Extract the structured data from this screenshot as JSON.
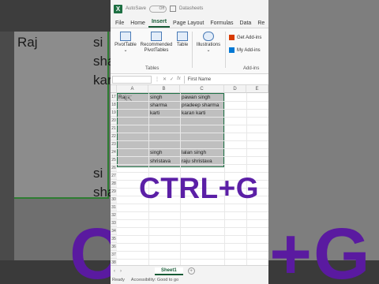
{
  "background": {
    "cells": [
      "Raj",
      "si",
      "sha",
      "kar",
      "si",
      "sha"
    ],
    "overlay_text": "CTRL+G"
  },
  "window": {
    "autosave_label": "AutoSave",
    "toggle_state": "Off",
    "workbook_name": "Datasheets"
  },
  "tabs": [
    "File",
    "Home",
    "Insert",
    "Page Layout",
    "Formulas",
    "Data",
    "Re"
  ],
  "active_tab": "Insert",
  "ribbon": {
    "pivot_table": "PivotTable",
    "recommended_pivot": "Recommended PivotTables",
    "table": "Table",
    "tables_group": "Tables",
    "illustrations": "Illustrations",
    "get_addins": "Get Add-ins",
    "my_addins": "My Add-ins",
    "addins_group": "Add-ins"
  },
  "formula_bar": {
    "fx_label": "fx",
    "value": "First Name"
  },
  "columns": [
    "A",
    "B",
    "C",
    "D",
    "E"
  ],
  "rows": [
    "17",
    "18",
    "19",
    "20",
    "21",
    "22",
    "23",
    "24",
    "25",
    "26",
    "27",
    "28",
    "29",
    "30",
    "31",
    "32",
    "33",
    "34",
    "35",
    "36",
    "37",
    "38"
  ],
  "cells": {
    "a1": "Raj",
    "b1": "singh",
    "c1": "pawan singh",
    "b2": "sharma",
    "c2": "pradeep sharma",
    "b3": "karti",
    "c3": "karan karti",
    "b8": "singh",
    "c8": "lalan singh",
    "b9": "shristava",
    "c9": "raju shristava"
  },
  "overlay_text": "CTRL+G",
  "sheet_tab": "Sheet1",
  "add_sheet": "+",
  "status": {
    "ready": "Ready",
    "accessibility": "Accessibility: Good to go"
  },
  "colors": {
    "excel_green": "#185c37",
    "selection_fill": "#bfbfbf",
    "overlay_purple": "#5b1fa6"
  }
}
